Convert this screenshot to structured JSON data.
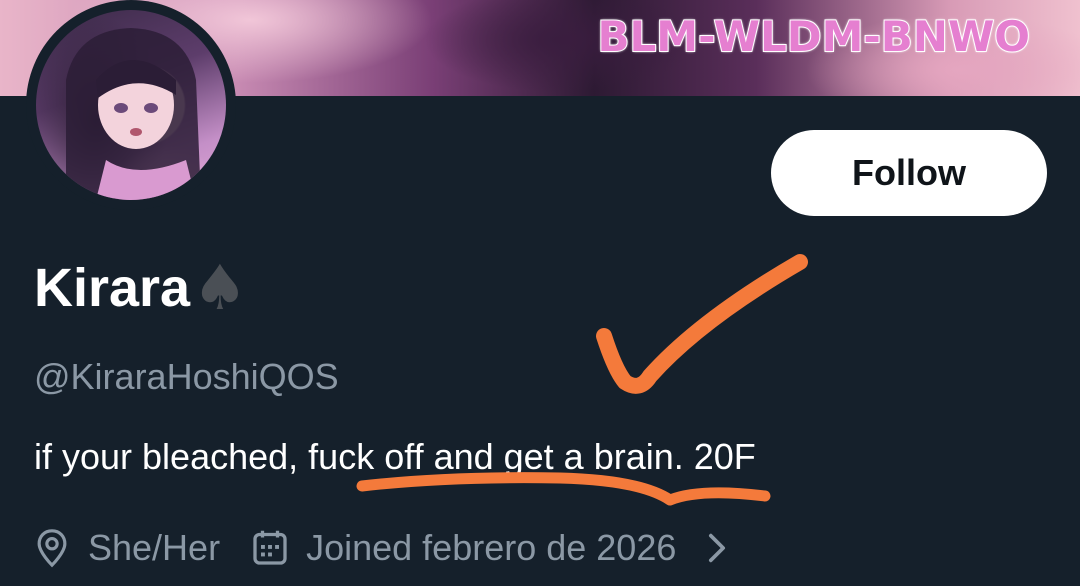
{
  "banner": {
    "title": "BLM-WLDM-BNWO"
  },
  "profile": {
    "follow_label": "Follow",
    "display_name": "Kirara",
    "name_emoji": "♠",
    "handle": "@KiraraHoshiQOS",
    "bio": "if your bleached, fuck off and get a brain. 20F",
    "pronouns": "She/Her",
    "joined": "Joined febrero de 2026"
  },
  "icons": {
    "pronouns_icon": "location-pin-icon",
    "joined_icon": "calendar-icon",
    "more_icon": "chevron-right-icon"
  },
  "colors": {
    "background": "#15202b",
    "secondary_text": "#8b98a5",
    "annotation": "#f47a3b",
    "banner_title": "#e57fd0"
  }
}
